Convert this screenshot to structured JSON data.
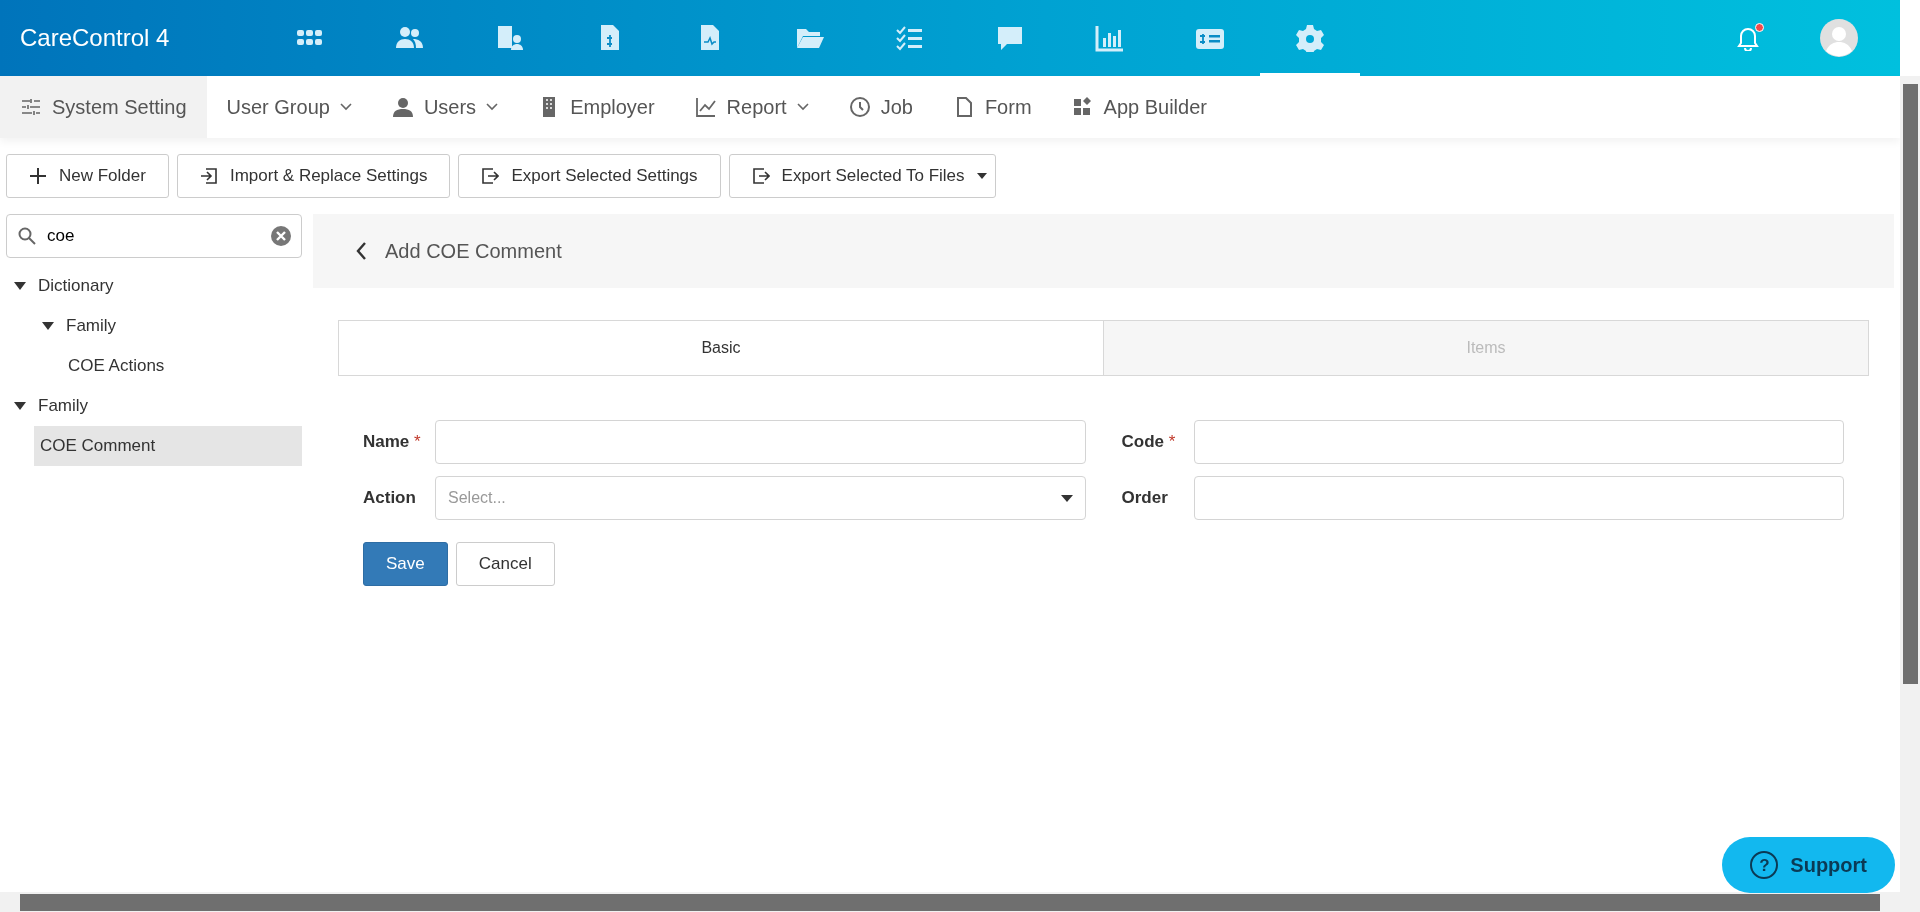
{
  "app": {
    "title": "CareControl 4"
  },
  "top_icons": [
    {
      "selected": false
    },
    {
      "selected": false
    },
    {
      "selected": false
    },
    {
      "selected": false
    },
    {
      "selected": false
    },
    {
      "selected": false
    },
    {
      "selected": false
    },
    {
      "selected": false
    },
    {
      "selected": false
    },
    {
      "selected": false
    },
    {
      "selected": true
    }
  ],
  "notifications": {
    "unread": true
  },
  "sub_nav": [
    {
      "label": "System Setting",
      "dropdown": false,
      "selected": true
    },
    {
      "label": "User Group",
      "dropdown": true,
      "selected": false
    },
    {
      "label": "Users",
      "dropdown": true,
      "selected": false
    },
    {
      "label": "Employer",
      "dropdown": false,
      "selected": false
    },
    {
      "label": "Report",
      "dropdown": true,
      "selected": false
    },
    {
      "label": "Job",
      "dropdown": false,
      "selected": false
    },
    {
      "label": "Form",
      "dropdown": false,
      "selected": false
    },
    {
      "label": "App Builder",
      "dropdown": false,
      "selected": false
    }
  ],
  "toolbar": [
    {
      "label": "New Folder",
      "dropdown": false
    },
    {
      "label": "Import & Replace Settings",
      "dropdown": false
    },
    {
      "label": "Export Selected Settings",
      "dropdown": false
    },
    {
      "label": "Export Selected To Files",
      "dropdown": true
    }
  ],
  "search": {
    "value": "coe"
  },
  "tree": [
    {
      "label": "Dictionary",
      "expanded": true,
      "selected": false,
      "children": [
        {
          "label": "Family",
          "expanded": true,
          "selected": false,
          "children": [
            {
              "label": "COE Actions",
              "selected": false
            }
          ]
        }
      ]
    },
    {
      "label": "Family",
      "expanded": true,
      "selected": false,
      "children": [
        {
          "label": "COE Comment",
          "selected": true
        }
      ]
    }
  ],
  "panel": {
    "title": "Add COE Comment"
  },
  "tabs": [
    {
      "label": "Basic",
      "selected": true
    },
    {
      "label": "Items",
      "selected": false
    }
  ],
  "fields": [
    {
      "label": "Name",
      "kind": "text",
      "required_mark": "*"
    },
    {
      "label": "Code",
      "kind": "text",
      "required_mark": "*"
    },
    {
      "label": "Action",
      "kind": "select",
      "placeholder": "Select..."
    },
    {
      "label": "Order",
      "kind": "text"
    }
  ],
  "actions": [
    {
      "label": "Save",
      "kind": "primary"
    },
    {
      "label": "Cancel",
      "kind": "secondary"
    }
  ],
  "support": {
    "icon": "?",
    "label": "Support"
  }
}
